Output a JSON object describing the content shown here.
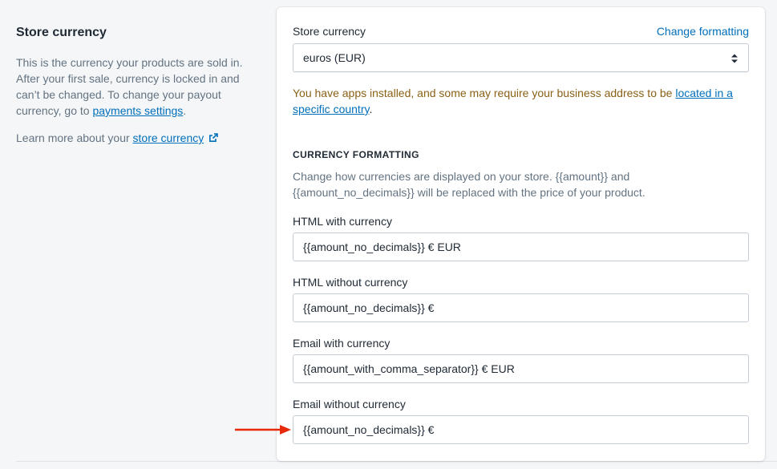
{
  "left": {
    "title": "Store currency",
    "description_1": "This is the currency your products are sold in. After your first sale, currency is locked in and can’t be changed. To change your payout currency, go to",
    "payments_link": "payments settings",
    "description_1_end": ".",
    "learn_more_prefix": "Learn more about your",
    "store_currency_link": "store currency",
    "external_icon": "external-link-icon"
  },
  "card": {
    "store_currency_label": "Store currency",
    "change_formatting_link": "Change formatting",
    "currency_select_value": "euros (EUR)",
    "select_icon": "select-arrows-icon",
    "warning_text": "You have apps installed, and some may require your business address to be",
    "warning_link": "located in a specific country",
    "warning_end": ".",
    "formatting_title": "CURRENCY FORMATTING",
    "formatting_desc": "Change how currencies are displayed on your store. {{amount}} and {{amount_no_decimals}} will be replaced with the price of your product.",
    "fields": [
      {
        "label": "HTML with currency",
        "value": "{{amount_no_decimals}} € EUR"
      },
      {
        "label": "HTML without currency",
        "value": "{{amount_no_decimals}} €"
      },
      {
        "label": "Email with currency",
        "value": "{{amount_with_comma_separator}} € EUR"
      },
      {
        "label": "Email without currency",
        "value": "{{amount_no_decimals}} €"
      }
    ]
  },
  "colors": {
    "link": "#006fbb",
    "warning": "#8a6116",
    "annotation_arrow": "#e8290b"
  }
}
